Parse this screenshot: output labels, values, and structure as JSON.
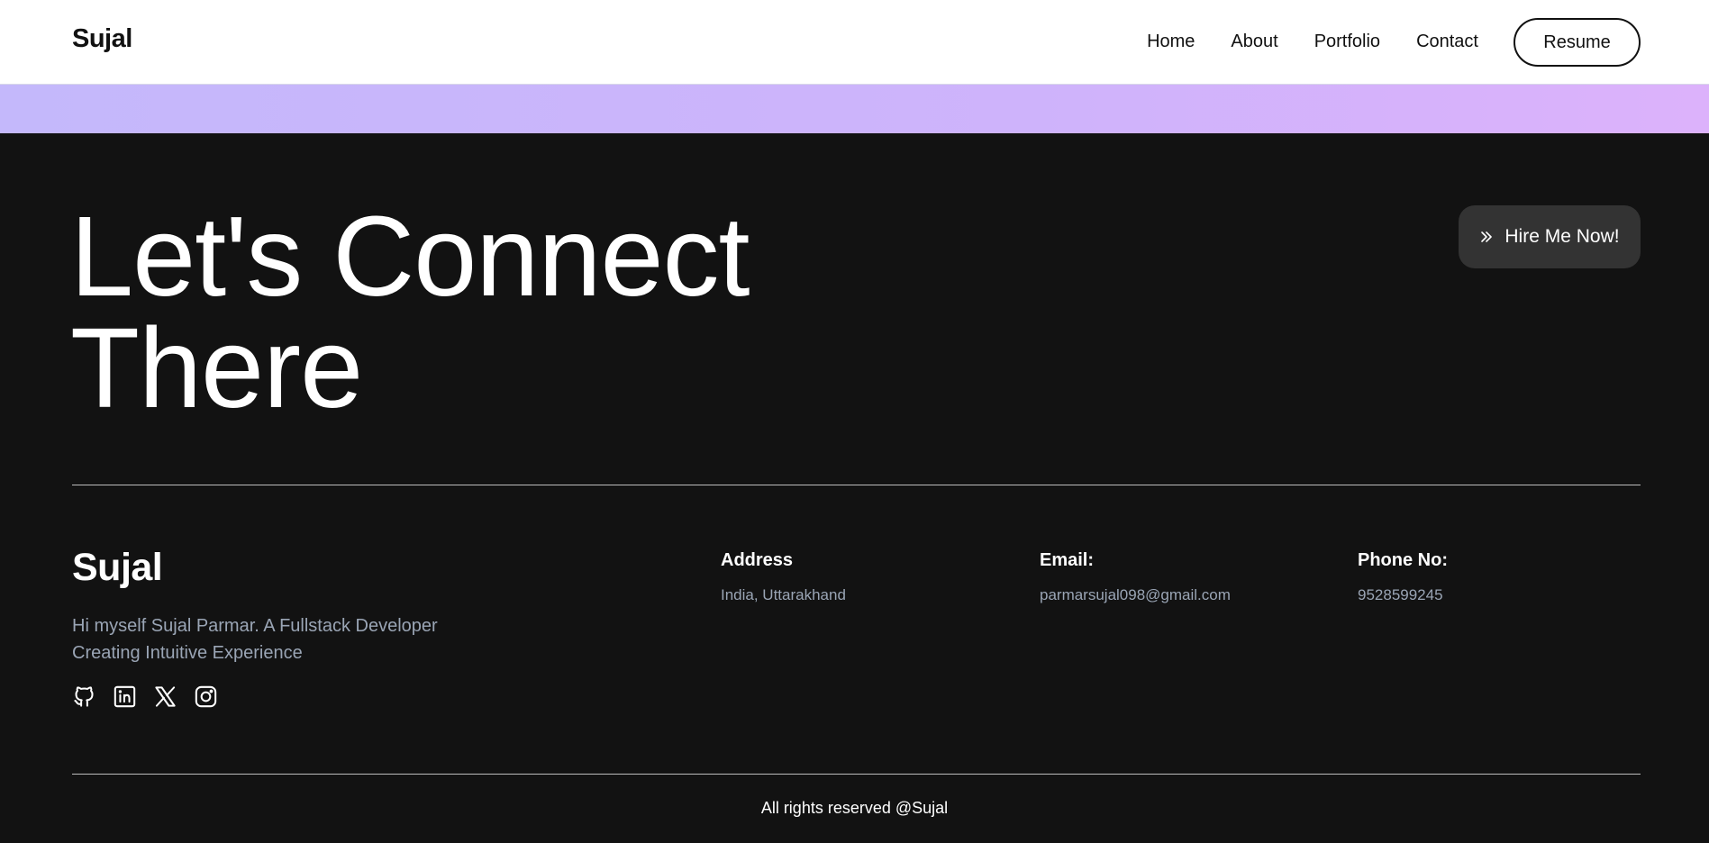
{
  "nav": {
    "brand": "Sujal",
    "links": [
      "Home",
      "About",
      "Portfolio",
      "Contact"
    ],
    "resume_label": "Resume"
  },
  "hero": {
    "line1": "Let's Connect",
    "line2": "There",
    "hire_label": "Hire Me Now!"
  },
  "footer": {
    "brand": "Sujal",
    "desc_line1": "Hi myself Sujal Parmar. A Fullstack Developer",
    "desc_line2": "Creating Intuitive Experience",
    "socials": [
      "github-icon",
      "linkedin-icon",
      "x-icon",
      "instagram-icon"
    ],
    "address_label": "Address",
    "address_value": "India, Uttarakhand",
    "email_label": "Email:",
    "email_value": "parmarsujal098@gmail.com",
    "phone_label": "Phone No:",
    "phone_value": "9528599245",
    "copyright": "All rights reserved @Sujal"
  },
  "colors": {
    "nav_bg": "#ffffff",
    "gradient_start": "#c4b8fb",
    "gradient_end": "#dcb2fb",
    "footer_bg": "#121212",
    "hire_btn_bg": "#333333",
    "muted_text": "#9aa5b5"
  }
}
